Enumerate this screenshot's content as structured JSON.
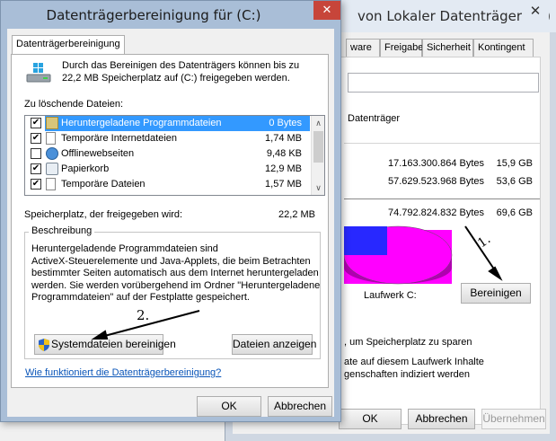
{
  "bg_window": {
    "title": "von Lokaler Datenträger (C:)",
    "close_icon": "close-icon",
    "tabs": [
      "ware",
      "Freigabe",
      "Sicherheit",
      "Kontingent"
    ],
    "type_label": "Datenträger",
    "rows": [
      {
        "bytes": "17.163.300.864 Bytes",
        "gb": "15,9 GB"
      },
      {
        "bytes": "57.629.523.968 Bytes",
        "gb": "53,6 GB"
      },
      {
        "bytes": "74.792.824.832 Bytes",
        "gb": "69,6 GB"
      }
    ],
    "drive_label": "Laufwerk C:",
    "cleanup_button": "Bereinigen",
    "compress_text": ", um Speicherplatz zu sparen",
    "index_text_1": "ate auf diesem Laufwerk Inhalte",
    "index_text_2": "genschaften indiziert werden",
    "ok_button": "OK",
    "cancel_button": "Abbrechen",
    "apply_button": "Übernehmen",
    "pie_colors": {
      "free": "#ff00ff",
      "used": "#2828ff"
    }
  },
  "cleanup_window": {
    "title": "Datenträgerbereinigung  für  (C:)",
    "tab": "Datenträgerbereinigung",
    "intro_1": "Durch das Bereinigen des Datenträgers können bis zu",
    "intro_2": "22,2 MB Speicherplatz auf  (C:) freigegeben werden.",
    "files_label": "Zu löschende Dateien:",
    "files": [
      {
        "name": "Heruntergeladene Programmdateien",
        "size": "0 Bytes",
        "checked": true,
        "selected": true,
        "icon": "folder-icon"
      },
      {
        "name": "Temporäre Internetdateien",
        "size": "1,74 MB",
        "checked": true,
        "selected": false,
        "icon": "document-icon"
      },
      {
        "name": "Offlinewebseiten",
        "size": "9,48 KB",
        "checked": false,
        "selected": false,
        "icon": "globe-icon"
      },
      {
        "name": "Papierkorb",
        "size": "12,9 MB",
        "checked": true,
        "selected": false,
        "icon": "recycle-bin-icon"
      },
      {
        "name": "Temporäre Dateien",
        "size": "1,57 MB",
        "checked": true,
        "selected": false,
        "icon": "document-icon"
      }
    ],
    "freed_label": "Speicherplatz, der freigegeben wird:",
    "freed_value": "22,2 MB",
    "description_legend": "Beschreibung",
    "description_lines": [
      "Heruntergeladende Programmdateien sind",
      "ActiveX-Steuerelemente und Java-Applets, die beim Betrachten",
      "bestimmter Seiten automatisch aus dem Internet heruntergeladen",
      "werden. Sie werden vorübergehend im Ordner \"Heruntergeladene",
      "Programmdateien\" auf der Festplatte gespeichert."
    ],
    "system_button": "Systemdateien bereinigen",
    "show_files_button": "Dateien anzeigen",
    "help_link": "Wie funktioniert die Datenträgerbereinigung?",
    "ok_button": "OK",
    "cancel_button": "Abbrechen"
  },
  "annotations": {
    "step1": "1.",
    "step2": "2."
  }
}
